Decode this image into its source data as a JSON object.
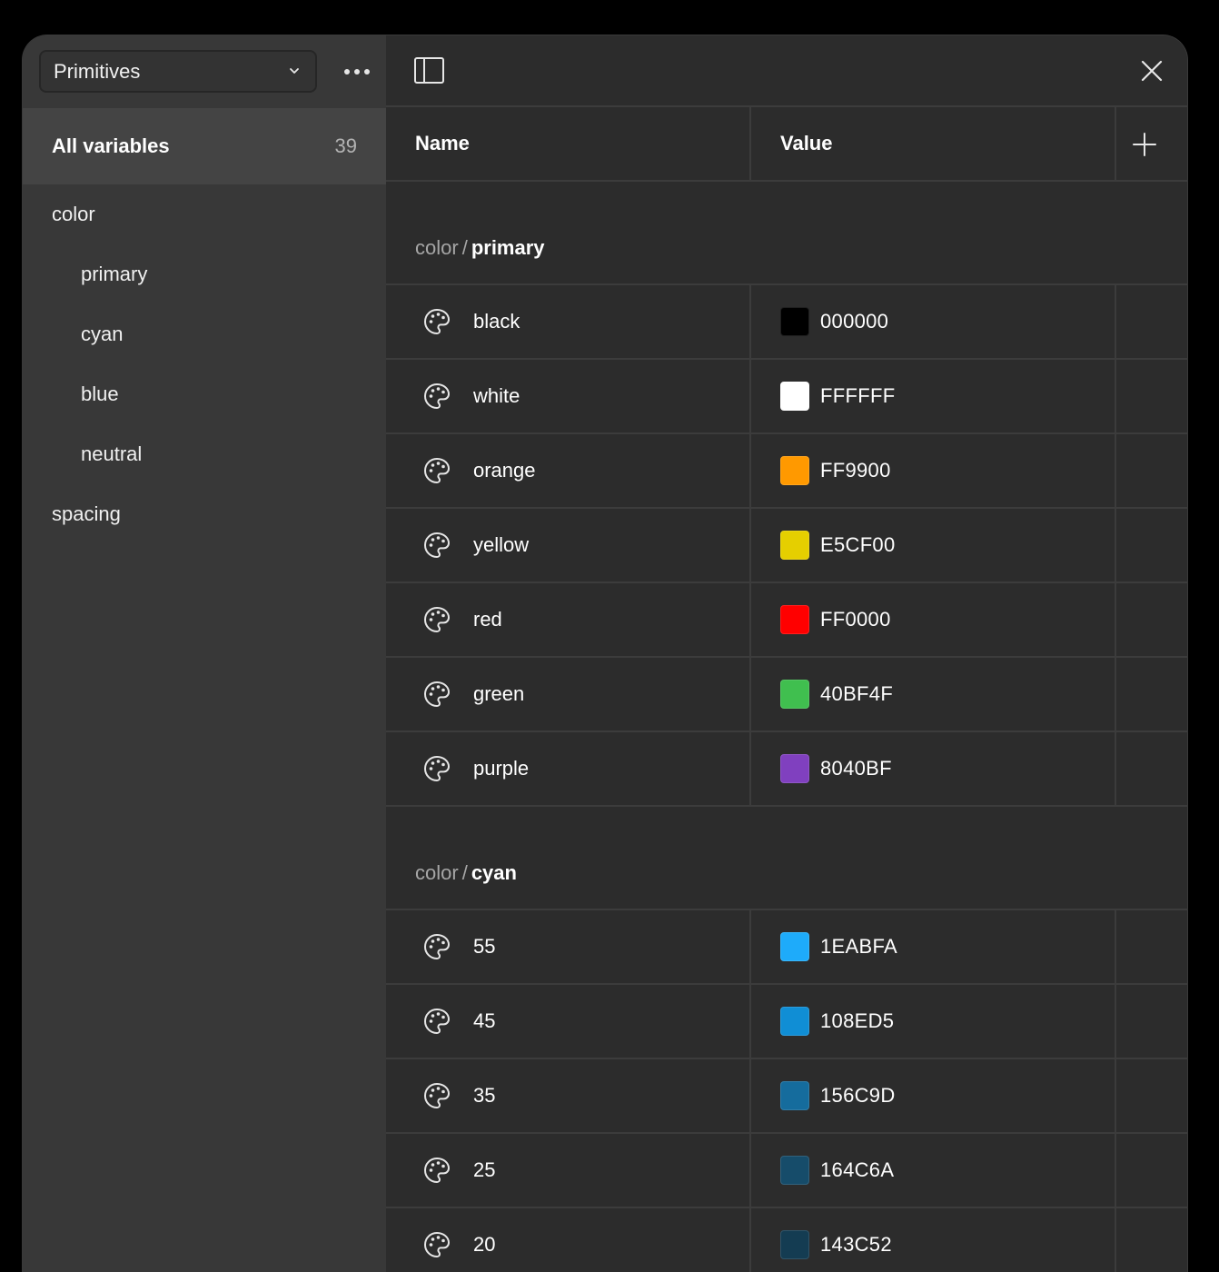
{
  "sidebar": {
    "collection": "Primitives",
    "all_variables": {
      "label": "All variables",
      "count": "39"
    },
    "groups": [
      {
        "label": "color",
        "level": 0
      },
      {
        "label": "primary",
        "level": 1
      },
      {
        "label": "cyan",
        "level": 1
      },
      {
        "label": "blue",
        "level": 1
      },
      {
        "label": "neutral",
        "level": 1
      },
      {
        "label": "spacing",
        "level": 0
      }
    ]
  },
  "table": {
    "name_header": "Name",
    "value_header": "Value"
  },
  "sections": [
    {
      "group": "color",
      "separator": "/",
      "subgroup": "primary",
      "rows": [
        {
          "name": "black",
          "value": "000000",
          "color": "#000000"
        },
        {
          "name": "white",
          "value": "FFFFFF",
          "color": "#FFFFFF"
        },
        {
          "name": "orange",
          "value": "FF9900",
          "color": "#FF9900"
        },
        {
          "name": "yellow",
          "value": "E5CF00",
          "color": "#E5CF00"
        },
        {
          "name": "red",
          "value": "FF0000",
          "color": "#FF0000"
        },
        {
          "name": "green",
          "value": "40BF4F",
          "color": "#40BF4F"
        },
        {
          "name": "purple",
          "value": "8040BF",
          "color": "#8040BF"
        }
      ]
    },
    {
      "group": "color",
      "separator": "/",
      "subgroup": "cyan",
      "rows": [
        {
          "name": "55",
          "value": "1EABFA",
          "color": "#1EABFA"
        },
        {
          "name": "45",
          "value": "108ED5",
          "color": "#108ED5"
        },
        {
          "name": "35",
          "value": "156C9D",
          "color": "#156C9D"
        },
        {
          "name": "25",
          "value": "164C6A",
          "color": "#164C6A"
        },
        {
          "name": "20",
          "value": "143C52",
          "color": "#143C52"
        }
      ]
    }
  ],
  "icons": {
    "row_icon": "palette-icon",
    "collection_chevron": "chevron-down-icon",
    "more": "more-horizontal-icon",
    "panel": "sidebar-toggle-icon",
    "close": "close-icon",
    "add": "plus-icon"
  }
}
